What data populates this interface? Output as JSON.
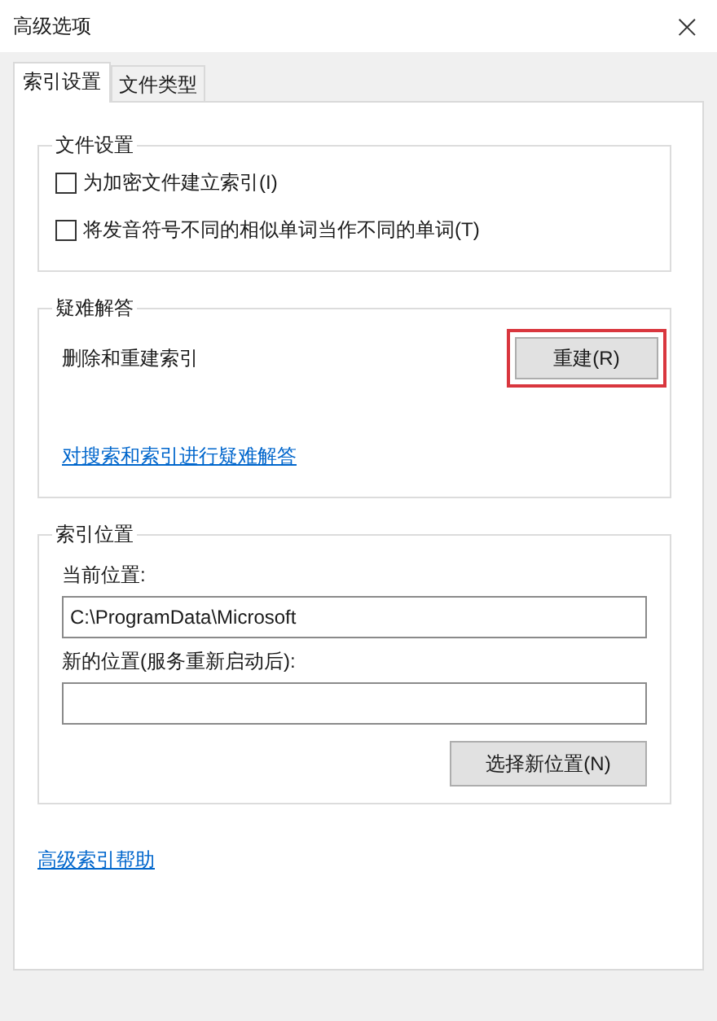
{
  "window": {
    "title": "高级选项",
    "close": "×"
  },
  "tabs": [
    {
      "label": "索引设置",
      "selected": true
    },
    {
      "label": "文件类型",
      "selected": false
    }
  ],
  "groups": [
    {
      "title": "文件设置",
      "items": [
        {
          "kind": "checkbox",
          "label": "为加密文件建立索引(I)",
          "checked": false
        },
        {
          "kind": "checkbox",
          "label": "将发音符号不同的相似单词当作不同的单词(T)",
          "checked": false
        }
      ]
    },
    {
      "title": "疑难解答",
      "items": [
        {
          "kind": "action",
          "label": "删除和重建索引",
          "button": "重建(R)",
          "highlighted": true
        },
        {
          "kind": "link",
          "label": "对搜索和索引进行疑难解答"
        }
      ]
    },
    {
      "title": "索引位置",
      "items": [
        {
          "kind": "field",
          "label": "当前位置:",
          "value": "C:\\ProgramData\\Microsoft"
        },
        {
          "kind": "field",
          "label": "新的位置(服务重新启动后):",
          "value": ""
        },
        {
          "kind": "button",
          "button": "选择新位置(N)"
        }
      ]
    }
  ],
  "help_link": "高级索引帮助"
}
